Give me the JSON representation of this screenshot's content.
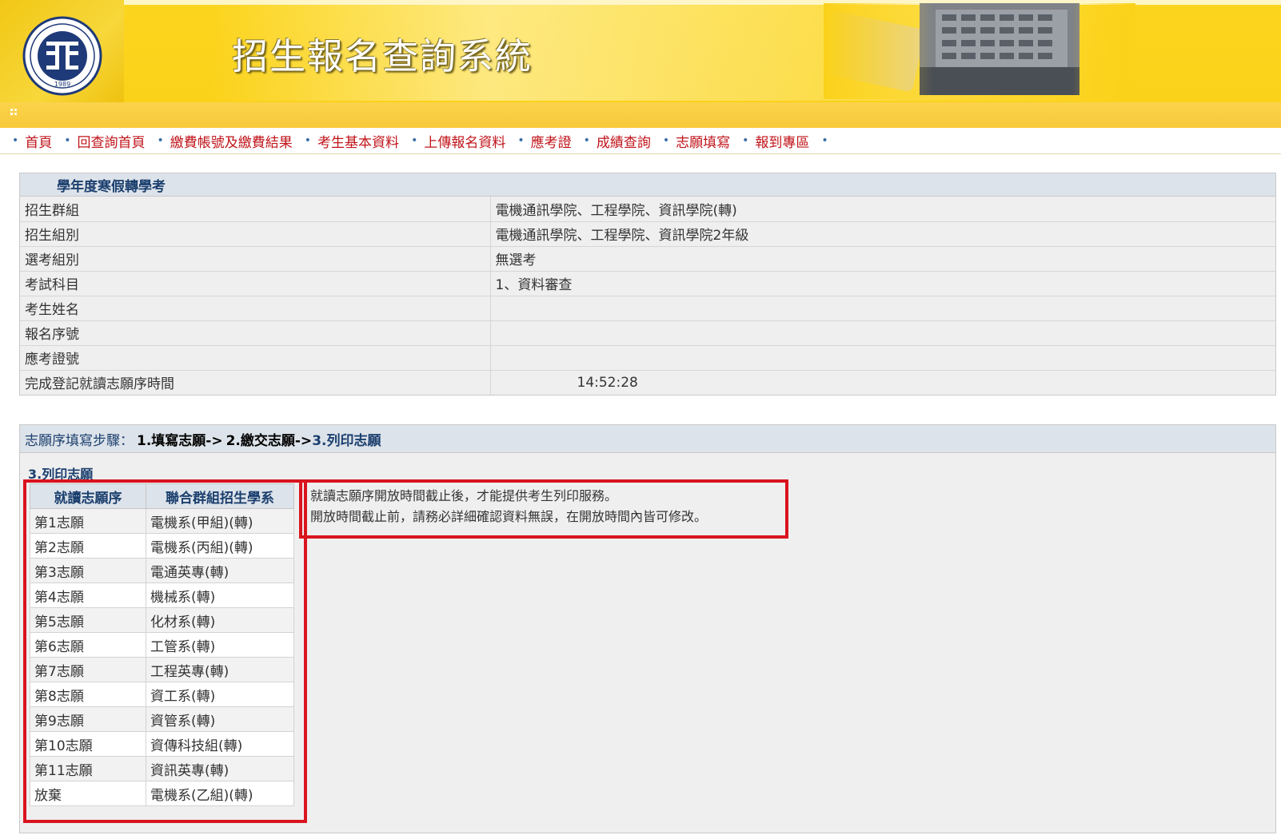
{
  "header": {
    "title": "招生報名查詢系統",
    "logo": {
      "year": "1989",
      "icon": "yuan-ze-university-seal"
    },
    "illustration": "campus-building-with-enter-key"
  },
  "nav": {
    "items": [
      {
        "label": "首頁"
      },
      {
        "label": "回查詢首頁"
      },
      {
        "label": "繳費帳號及繳費結果"
      },
      {
        "label": "考生基本資料"
      },
      {
        "label": "上傳報名資料"
      },
      {
        "label": "應考證"
      },
      {
        "label": "成績查詢"
      },
      {
        "label": "志願填寫"
      },
      {
        "label": "報到專區"
      }
    ],
    "bullet": "•"
  },
  "exam_info": {
    "heading": "學年度寒假轉學考",
    "rows": [
      {
        "label": "招生群組",
        "value": "電機通訊學院、工程學院、資訊學院(轉)"
      },
      {
        "label": "招生組別",
        "value": "電機通訊學院、工程學院、資訊學院2年級"
      },
      {
        "label": "選考組別",
        "value": "無選考"
      },
      {
        "label": "考試科目",
        "value": "1、資料審查"
      },
      {
        "label": "考生姓名",
        "value": ""
      },
      {
        "label": "報名序號",
        "value": ""
      },
      {
        "label": "應考證號",
        "value": ""
      },
      {
        "label": "完成登記就讀志願序時間",
        "value": "14:52:28"
      }
    ]
  },
  "steps": {
    "prefix": "志願序填寫步驟：",
    "step1": "1.填寫志願->",
    "step2": "2.繳交志願->",
    "step3": "3.列印志願",
    "section_title": "3.列印志願",
    "table": {
      "headers": [
        "就讀志願序",
        "聯合群組招生學系"
      ],
      "rows": [
        [
          "第1志願",
          "電機系(甲組)(轉)"
        ],
        [
          "第2志願",
          "電機系(丙組)(轉)"
        ],
        [
          "第3志願",
          "電通英專(轉)"
        ],
        [
          "第4志願",
          "機械系(轉)"
        ],
        [
          "第5志願",
          "化材系(轉)"
        ],
        [
          "第6志願",
          "工管系(轉)"
        ],
        [
          "第7志願",
          "工程英專(轉)"
        ],
        [
          "第8志願",
          "資工系(轉)"
        ],
        [
          "第9志願",
          "資管系(轉)"
        ],
        [
          "第10志願",
          "資傳科技組(轉)"
        ],
        [
          "第11志願",
          "資訊英專(轉)"
        ],
        [
          "放棄",
          "電機系(乙組)(轉)"
        ]
      ]
    },
    "note_line1": "就讀志願序開放時間截止後，才能提供考生列印服務。",
    "note_line2": "開放時間截止前，請務必詳細確認資料無誤，在開放時間內皆可修改。"
  },
  "colors": {
    "banner": "#fbd21a",
    "nav_link": "#c0141a",
    "highlight_box": "#d9141e",
    "heading_text": "#1b3f6e"
  }
}
